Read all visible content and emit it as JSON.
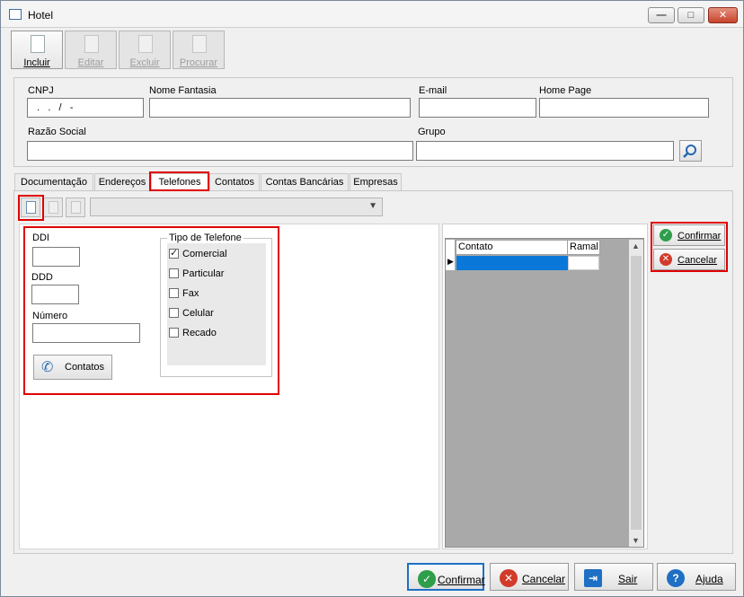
{
  "window": {
    "title": "Hotel"
  },
  "toolbar": {
    "buttons": [
      {
        "label": "Incluir",
        "icon": "new-document-icon",
        "enabled": true
      },
      {
        "label": "Editar",
        "icon": "edit-document-icon",
        "enabled": false
      },
      {
        "label": "Excluir",
        "icon": "delete-document-icon",
        "enabled": false
      },
      {
        "label": "Procurar",
        "icon": "search-document-icon",
        "enabled": false
      }
    ]
  },
  "form": {
    "cnpj_label": "CNPJ",
    "cnpj_value": "  .   .   /   -",
    "nome_fantasia_label": "Nome Fantasia",
    "nome_fantasia_value": "",
    "email_label": "E-mail",
    "email_value": "",
    "home_page_label": "Home Page",
    "home_page_value": "",
    "razao_social_label": "Razão Social",
    "razao_social_value": "",
    "grupo_label": "Grupo",
    "grupo_value": ""
  },
  "tabs": [
    {
      "label": "Documentação"
    },
    {
      "label": "Endereços"
    },
    {
      "label": "Telefones",
      "selected": true
    },
    {
      "label": "Contatos"
    },
    {
      "label": "Contas Bancárias"
    },
    {
      "label": "Empresas"
    }
  ],
  "phone": {
    "ddi_label": "DDI",
    "ddi_value": "",
    "ddd_label": "DDD",
    "ddd_value": "",
    "numero_label": "Número",
    "numero_value": "",
    "tipo_title": "Tipo de Telefone",
    "tipos": [
      {
        "label": "Comercial",
        "checked": true
      },
      {
        "label": "Particular",
        "checked": false
      },
      {
        "label": "Fax",
        "checked": false
      },
      {
        "label": "Celular",
        "checked": false
      },
      {
        "label": "Recado",
        "checked": false
      }
    ],
    "contatos_button": "Contatos"
  },
  "grid": {
    "columns": [
      "Contato",
      "Ramal"
    ]
  },
  "side_buttons": {
    "confirmar": "Confirmar",
    "cancelar": "Cancelar"
  },
  "bottom_buttons": {
    "confirmar": "Confirmar",
    "cancelar": "Cancelar",
    "sair": "Sair",
    "ajuda": "Ajuda"
  },
  "colors": {
    "highlight": "#e00000",
    "selection": "#0a78d8",
    "confirm": "#2e9e4a",
    "cancel": "#d23a2a",
    "help": "#1f6fc4"
  }
}
